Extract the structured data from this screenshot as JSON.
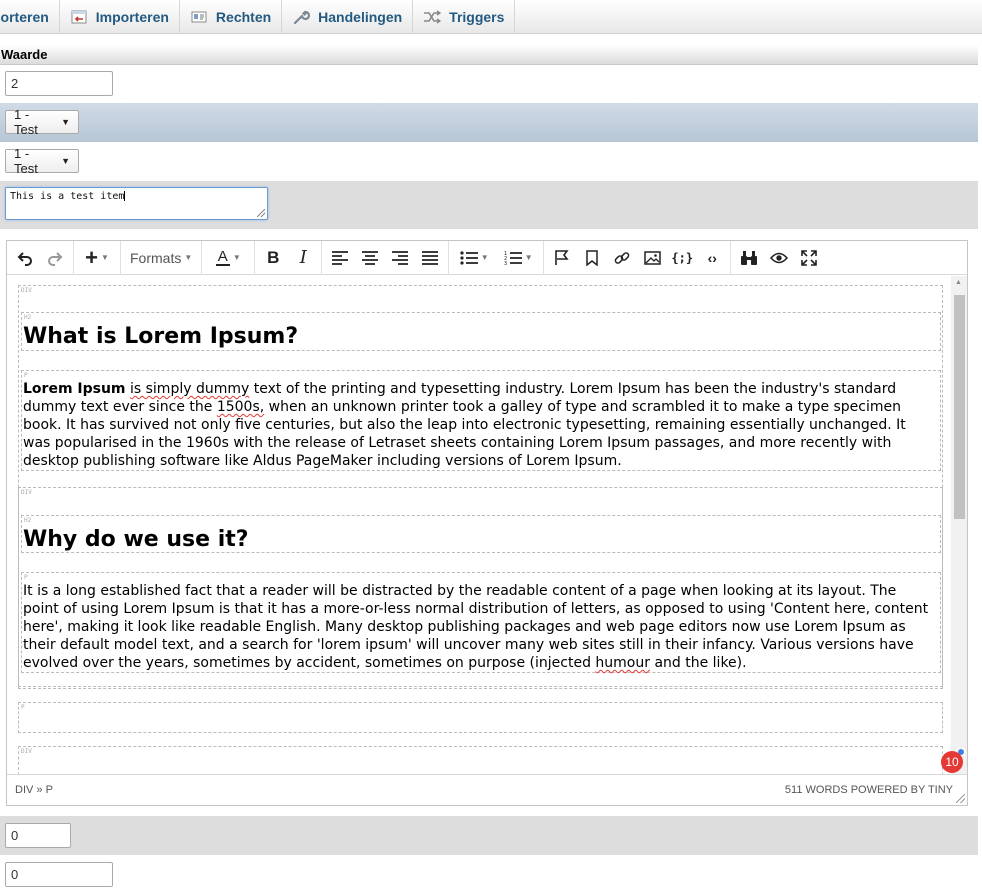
{
  "tabs": [
    {
      "label": "porteren",
      "icon": "export-icon"
    },
    {
      "label": "Importeren",
      "icon": "import-icon"
    },
    {
      "label": "Rechten",
      "icon": "rights-icon"
    },
    {
      "label": "Handelingen",
      "icon": "wrench-icon"
    },
    {
      "label": "Triggers",
      "icon": "trigger-icon"
    }
  ],
  "form": {
    "column_header": "Waarde",
    "value_field": "2",
    "select_1": "1 - Test",
    "select_2": "1 - Test",
    "textarea_value": "This is a test item",
    "bottom_field_1": "0",
    "bottom_field_2": "0"
  },
  "editor": {
    "toolbar": {
      "formats_label": "Formats"
    },
    "content": {
      "block_tags": {
        "div": "DIV",
        "h2": "H2",
        "p": "P"
      },
      "heading_1": "What is Lorem Ipsum?",
      "para_1": {
        "bold": "Lorem Ipsum",
        "sp1": "is simply dummy",
        "t1": " text of the printing and typesetting industry. Lorem Ipsum has been the industry's standard dummy text ever since the ",
        "sp2": "1500s,",
        "t2": " when an unknown printer took a galley of type and scrambled it to make a type specimen book. It has survived not only five centuries, but also the leap into electronic typesetting, remaining essentially unchanged. It was popularised in the 1960s with the release of Letraset sheets containing Lorem Ipsum passages, and more recently with desktop publishing software like Aldus PageMaker including versions of Lorem Ipsum."
      },
      "heading_2": "Why do we use it?",
      "para_2": {
        "t1": "It is a long established fact that a reader will be distracted by the readable content of a page when looking at its layout. The point of using Lorem Ipsum is that it has a more-or-less normal distribution of letters, as opposed to using 'Content here, content here', making it look like readable English. Many desktop publishing packages and web page editors now use Lorem Ipsum as their default model text, and a search for 'lorem ipsum' will uncover many web sites still in their infancy. Various versions have evolved over the years, sometimes by accident, sometimes on purpose (injected ",
        "sp": "humour",
        "t2": " and the like)."
      }
    },
    "status": {
      "path": "DIV » P",
      "word_count": "511 WORDS POWERED BY TINY"
    },
    "notification_count": "10"
  },
  "colors": {
    "tab_text": "#235a81",
    "blue_row": "#c4d2e0",
    "grey_row": "#dddddd",
    "spell_underline": "#e53935",
    "badge": "#e53935"
  }
}
